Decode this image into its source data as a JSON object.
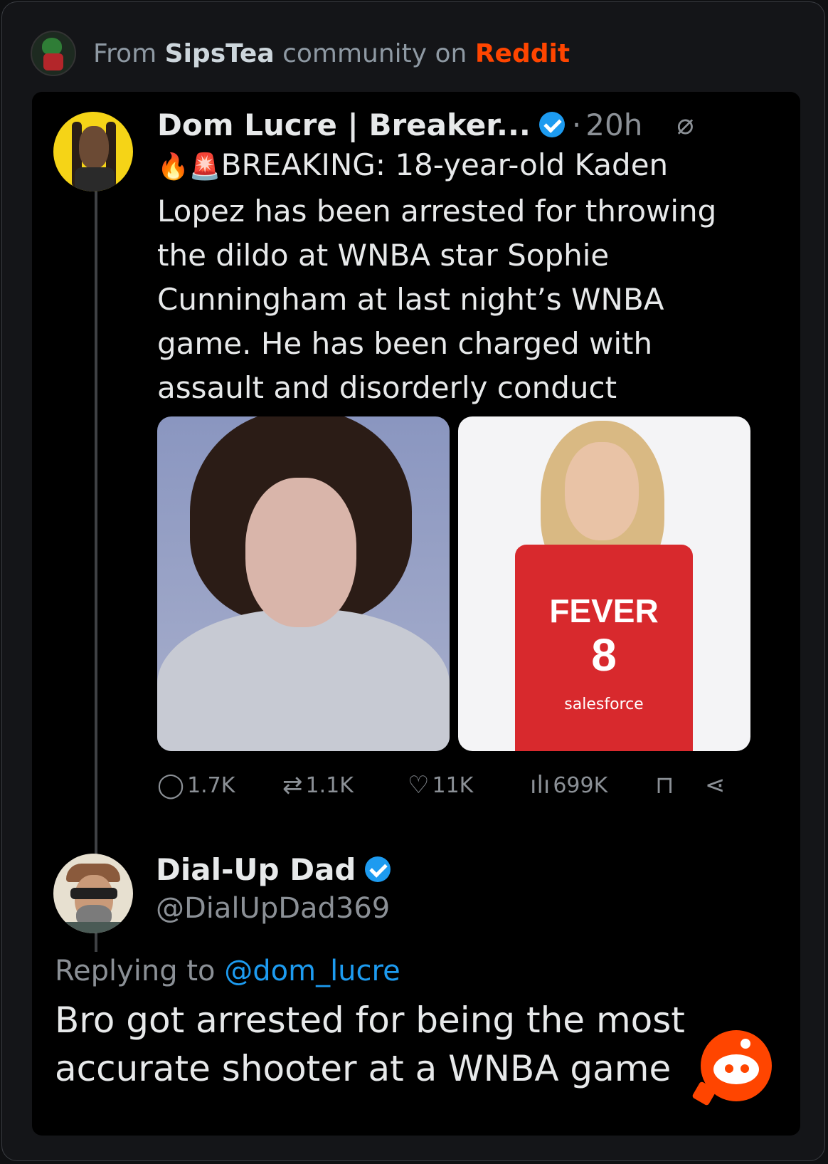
{
  "source": {
    "prefix": "From",
    "community": "SipsTea",
    "middle": "community on",
    "brand": "Reddit"
  },
  "tweet": {
    "author": "Dom Lucre | Breaker...",
    "dot": "·",
    "time": "20h",
    "emoji_lead": "🔥🚨",
    "text": "BREAKING: 18-year-old Kaden\nLopez has been arrested for throwing\nthe dildo at WNBA star Sophie\nCunningham at last night’s WNBA\ngame. He has been charged with\nassault and disorderly conduct",
    "jersey": {
      "team": "FEVER",
      "number": "8",
      "sponsor": "salesforce"
    },
    "stats": {
      "replies": "1.7K",
      "reposts": "1.1K",
      "likes": "11K",
      "views": "699K"
    }
  },
  "reply": {
    "author": "Dial-Up Dad",
    "handle": "@DialUpDad369",
    "replying_prefix": "Replying to",
    "replying_to": "@dom_lucre",
    "text": "Bro got arrested for being the most accurate shooter at a WNBA game"
  },
  "colors": {
    "reddit_orange": "#ff4500",
    "verified_blue": "#1d9bf0",
    "muted": "#8b9096"
  },
  "icons": [
    "reply-icon",
    "repost-icon",
    "like-icon",
    "views-icon",
    "bookmark-icon",
    "share-icon",
    "grok-icon",
    "verified-icon",
    "reddit-logo-icon"
  ]
}
